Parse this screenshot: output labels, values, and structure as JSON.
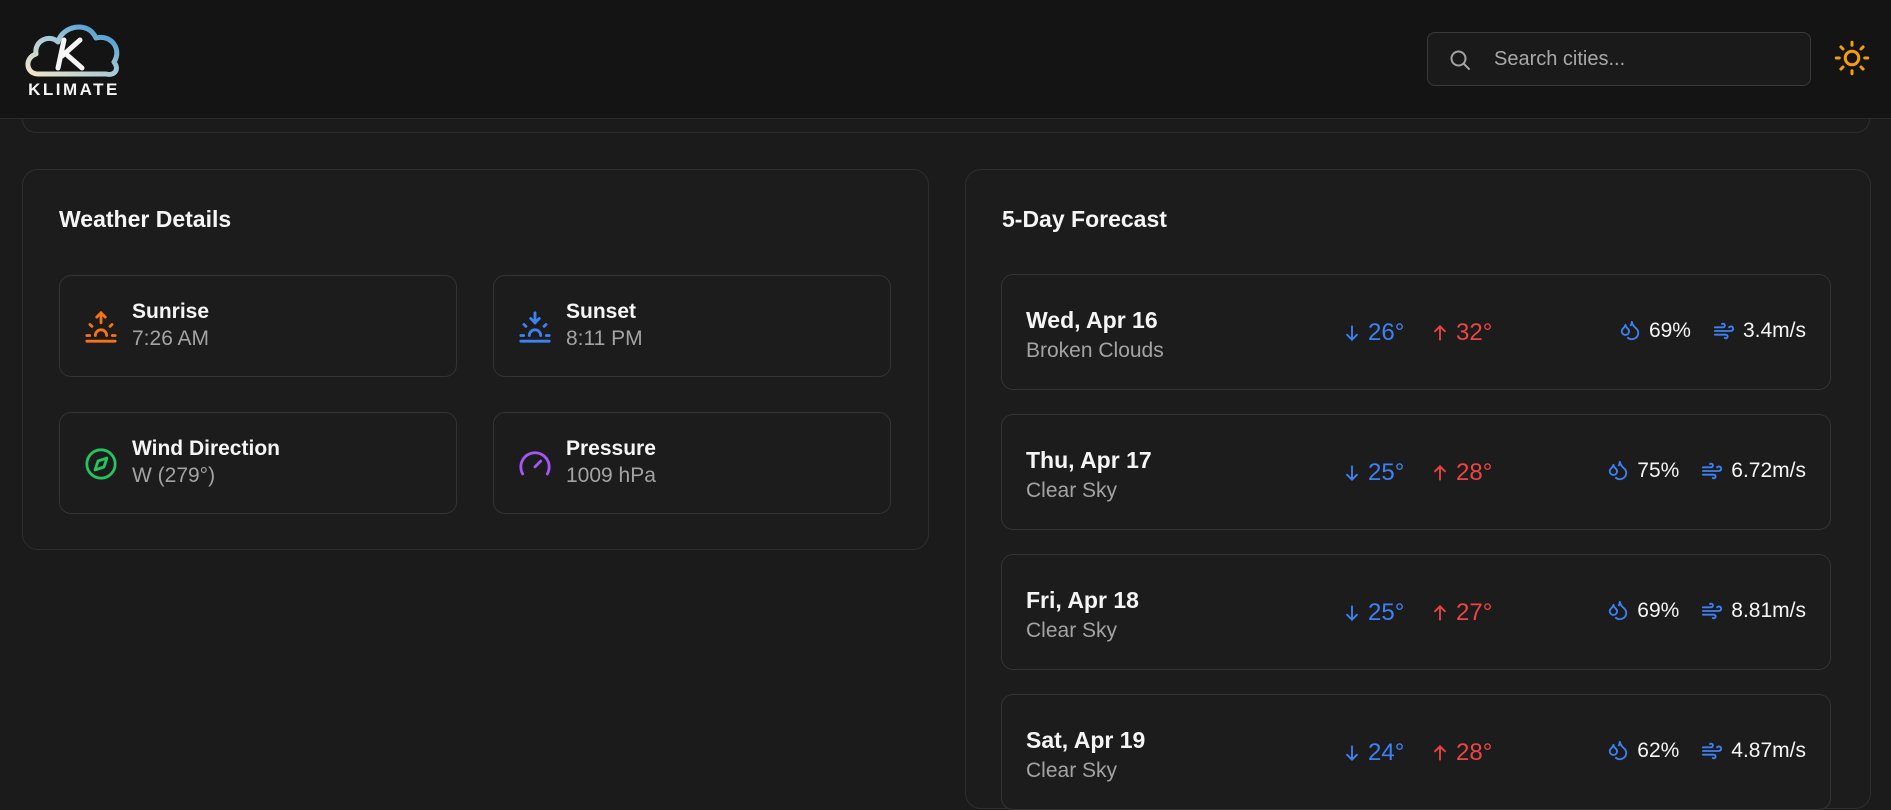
{
  "app": {
    "name": "KLIMATE"
  },
  "search": {
    "placeholder": "Search cities..."
  },
  "weather_details": {
    "title": "Weather Details",
    "items": [
      {
        "label": "Sunrise",
        "value": "7:26 AM",
        "icon": "sunrise-icon",
        "color": "#f97316"
      },
      {
        "label": "Sunset",
        "value": "8:11 PM",
        "icon": "sunset-icon",
        "color": "#3b82f6"
      },
      {
        "label": "Wind Direction",
        "value": "W (279°)",
        "icon": "compass-icon",
        "color": "#22c55e"
      },
      {
        "label": "Pressure",
        "value": "1009 hPa",
        "icon": "gauge-icon",
        "color": "#a855f7"
      }
    ]
  },
  "forecast": {
    "title": "5-Day Forecast",
    "days": [
      {
        "day": "Wed, Apr 16",
        "desc": "Broken Clouds",
        "min": "26°",
        "max": "32°",
        "humidity": "69%",
        "wind": "3.4m/s"
      },
      {
        "day": "Thu, Apr 17",
        "desc": "Clear Sky",
        "min": "25°",
        "max": "28°",
        "humidity": "75%",
        "wind": "6.72m/s"
      },
      {
        "day": "Fri, Apr 18",
        "desc": "Clear Sky",
        "min": "25°",
        "max": "27°",
        "humidity": "69%",
        "wind": "8.81m/s"
      },
      {
        "day": "Sat, Apr 19",
        "desc": "Clear Sky",
        "min": "24°",
        "max": "28°",
        "humidity": "62%",
        "wind": "4.87m/s"
      }
    ]
  },
  "colors": {
    "min_temp": "#3b82f6",
    "max_temp": "#ef4444",
    "accent_sun": "#f59e0b"
  }
}
